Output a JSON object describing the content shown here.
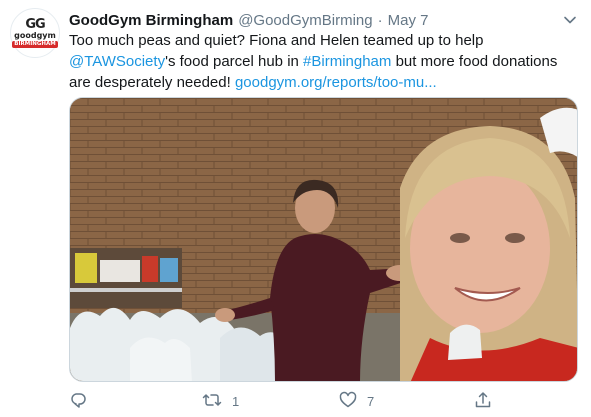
{
  "tweet": {
    "display_name": "GoodGym Birmingham",
    "handle": "@GoodGymBirming",
    "separator": "·",
    "date": "May 7",
    "text_parts": {
      "p1": "Too much peas and quiet? Fiona and Helen teamed up to help ",
      "mention": "@TAWSociety",
      "p2": "'s food parcel hub in ",
      "hashtag": "#Birmingham",
      "p3": " but more food donations are desperately needed! ",
      "url": "goodgym.org/reports/too-mu..."
    },
    "avatar": {
      "logo_text": "GG",
      "logo_word": "goodgym",
      "logo_city": "BIRMINGHAM"
    },
    "media_icon": "photo",
    "actions": {
      "reply": {
        "icon": "reply-icon",
        "count": ""
      },
      "retweet": {
        "icon": "retweet-icon",
        "count": "1"
      },
      "like": {
        "icon": "heart-icon",
        "count": "7"
      },
      "share": {
        "icon": "share-icon",
        "count": ""
      }
    }
  },
  "colors": {
    "link": "#1b95e0",
    "text": "#14171a",
    "secondary": "#657786",
    "brand_red": "#d62b2b"
  }
}
